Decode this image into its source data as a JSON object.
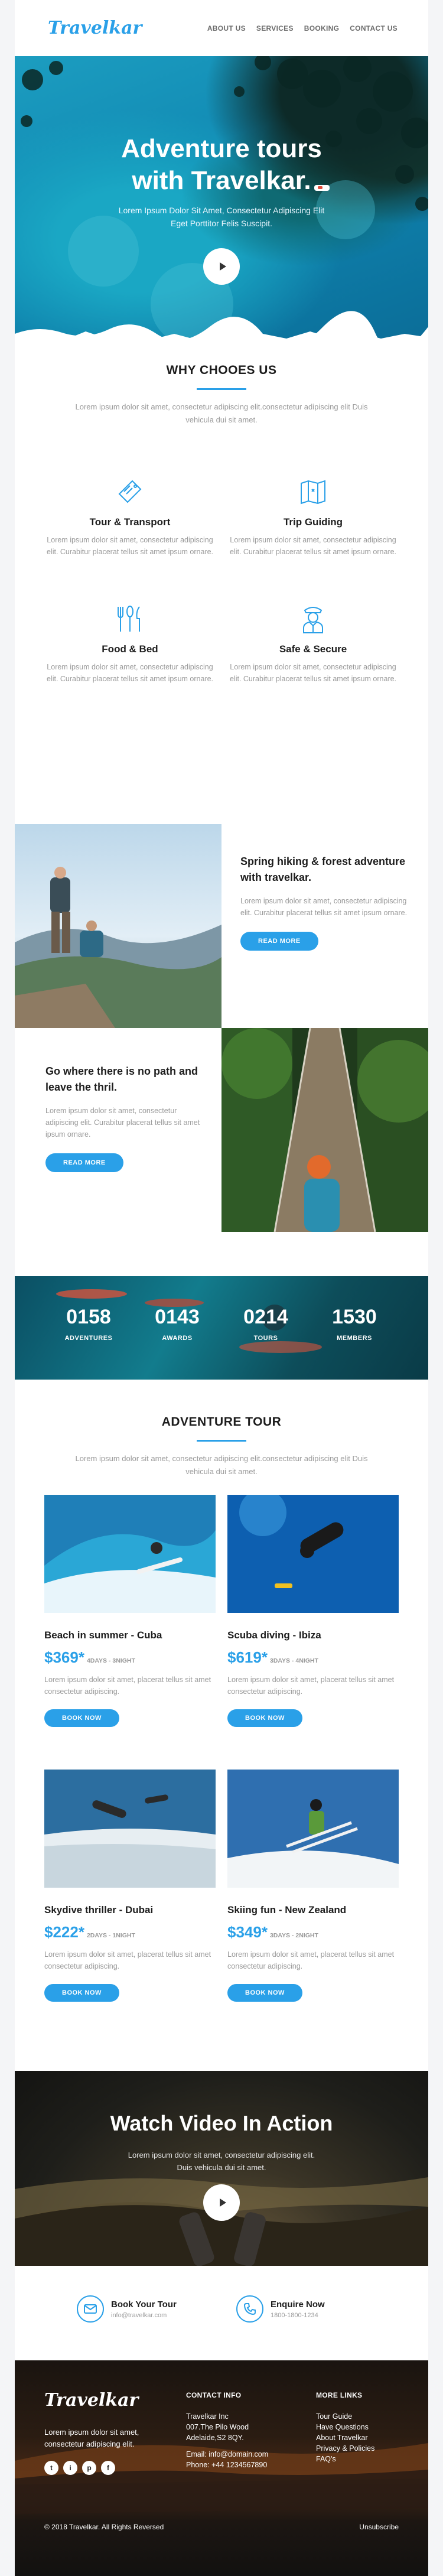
{
  "header": {
    "logo": "Travelkar",
    "nav": [
      "ABOUT US",
      "SERVICES",
      "BOOKING",
      "CONTACT US"
    ]
  },
  "hero": {
    "title_line1": "Adventure tours",
    "title_line2": "with Travelkar.",
    "subtitle_line1": "Lorem Ipsum Dolor Sit Amet, Consectetur Adipiscing Elit",
    "subtitle_line2": "Eget Porttitor Felis Suscipit.",
    "play_icon": "play-icon"
  },
  "why": {
    "title": "WHY CHOOES US",
    "desc": "Lorem ipsum dolor sit amet, consectetur adipiscing elit.consectetur adipiscing elit Duis vehicula dui sit amet.",
    "features": [
      {
        "icon": "ticket-icon",
        "title": "Tour & Transport",
        "text": "Lorem ipsum dolor sit amet, consectetur adipiscing elit. Curabitur placerat tellus sit amet ipsum ornare."
      },
      {
        "icon": "map-icon",
        "title": "Trip Guiding",
        "text": "Lorem ipsum dolor sit amet, consectetur adipiscing elit. Curabitur placerat tellus sit amet ipsum ornare."
      },
      {
        "icon": "cutlery-icon",
        "title": "Food & Bed",
        "text": "Lorem ipsum dolor sit amet, consectetur adipiscing elit. Curabitur placerat tellus sit amet ipsum ornare."
      },
      {
        "icon": "guard-icon",
        "title": "Safe & Secure",
        "text": "Lorem ipsum dolor sit amet, consectetur adipiscing elit. Curabitur placerat tellus sit amet ipsum ornare."
      }
    ]
  },
  "split1": {
    "title": "Spring hiking & forest adventure with travelkar.",
    "text": "Lorem ipsum dolor sit amet, consectetur adipiscing elit. Curabitur placerat tellus sit amet ipsum ornare.",
    "button": "READ MORE"
  },
  "split2": {
    "title": "Go where there is no path and leave the thril.",
    "text": "Lorem ipsum dolor sit amet, consectetur adipiscing elit. Curabitur placerat tellus sit amet ipsum ornare.",
    "button": "READ MORE"
  },
  "stats": [
    {
      "num": "0158",
      "label": "ADVENTURES"
    },
    {
      "num": "0143",
      "label": "AWARDS"
    },
    {
      "num": "0214",
      "label": "TOURS"
    },
    {
      "num": "1530",
      "label": "MEMBERS"
    }
  ],
  "tour": {
    "title": "ADVENTURE TOUR",
    "desc": "Lorem ipsum dolor sit amet, consectetur adipiscing elit.consectetur adipiscing elit Duis vehicula dui sit amet.",
    "cards": [
      {
        "title": "Beach in summer - Cuba",
        "price": "$369*",
        "days": "4DAYS - 3NIGHT",
        "text": "Lorem ipsum dolor sit amet, placerat tellus sit amet consectetur adipiscing.",
        "button": "BOOK NOW"
      },
      {
        "title": "Scuba diving - Ibiza",
        "price": "$619*",
        "days": "3DAYS - 4NIGHT",
        "text": "Lorem ipsum dolor sit amet, placerat tellus sit amet consectetur adipiscing.",
        "button": "BOOK NOW"
      },
      {
        "title": "Skydive thriller - Dubai",
        "price": "$222*",
        "days": "2DAYS - 1NIGHT",
        "text": "Lorem ipsum dolor sit amet, placerat tellus sit amet consectetur adipiscing.",
        "button": "BOOK NOW"
      },
      {
        "title": "Skiing fun - New Zealand",
        "price": "$349*",
        "days": "3DAYS - 2NIGHT",
        "text": "Lorem ipsum dolor sit amet, placerat tellus sit amet consectetur adipiscing.",
        "button": "BOOK NOW"
      }
    ]
  },
  "video": {
    "title": "Watch Video In Action",
    "text": "Lorem ipsum dolor sit amet, consectetur adipiscing elit. Duis vehicula dui sit amet."
  },
  "contact": {
    "book_title": "Book Your Tour",
    "book_sub": "info@travelkar.com",
    "enquire_title": "Enquire Now",
    "enquire_sub": "1800-1800-1234"
  },
  "footer": {
    "logo": "Travelkar",
    "desc": "Lorem ipsum dolor sit amet, consectetur adipiscing elit.",
    "socials": [
      "t",
      "i",
      "p",
      "f"
    ],
    "contact_title": "CONTACT INFO",
    "contact_lines": [
      "Travelkar Inc",
      "007.The Pilo Wood",
      "Adelaide,S2 8QY.",
      "",
      "Email: info@domain.com",
      "Phone: +44 1234567890"
    ],
    "links_title": "MORE LINKS",
    "links": [
      "Tour Guide",
      "Have Questions",
      "About Travelkar",
      "Privacy & Policies",
      "FAQ's"
    ],
    "copyright": "© 2018 Travelkar. All Rights Reversed",
    "unsubscribe": "Unsubscribe"
  },
  "colors": {
    "accent": "#2aa0e8",
    "text_dark": "#1d1d1d",
    "text_muted": "#9a9a9a"
  }
}
